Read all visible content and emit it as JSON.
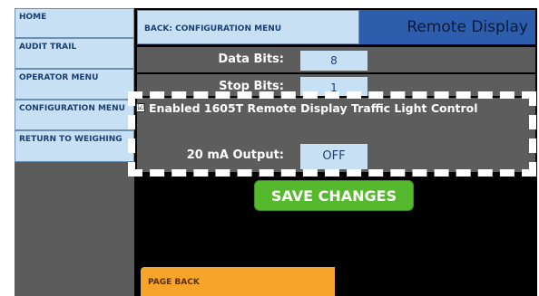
{
  "sidebar": {
    "items": [
      {
        "label": "HOME"
      },
      {
        "label": "AUDIT TRAIL"
      },
      {
        "label": "OPERATOR MENU"
      },
      {
        "label": "CONFIGURATION MENU"
      },
      {
        "label": "RETURN TO WEIGHING"
      }
    ]
  },
  "header": {
    "back_label": "BACK: CONFIGURATION MENU",
    "title": "Remote Display"
  },
  "settings": {
    "data_bits_label": "Data Bits:",
    "data_bits_value": "8",
    "stop_bits_label": "Stop Bits:",
    "stop_bits_value": "1",
    "traffic_light_label": "Enabled 1605T Remote Display Traffic Light Control",
    "traffic_light_checked": "☑",
    "output_label": "20 mA Output:",
    "output_value": "OFF"
  },
  "actions": {
    "save_label": "SAVE CHANGES",
    "page_back_label": "PAGE BACK"
  },
  "colors": {
    "nav_bg": "#c7e0f4",
    "title_bg": "#2d5dad",
    "save_bg": "#56b92d",
    "page_back_bg": "#f6a52a",
    "panel_bg": "#5d5d5d"
  }
}
